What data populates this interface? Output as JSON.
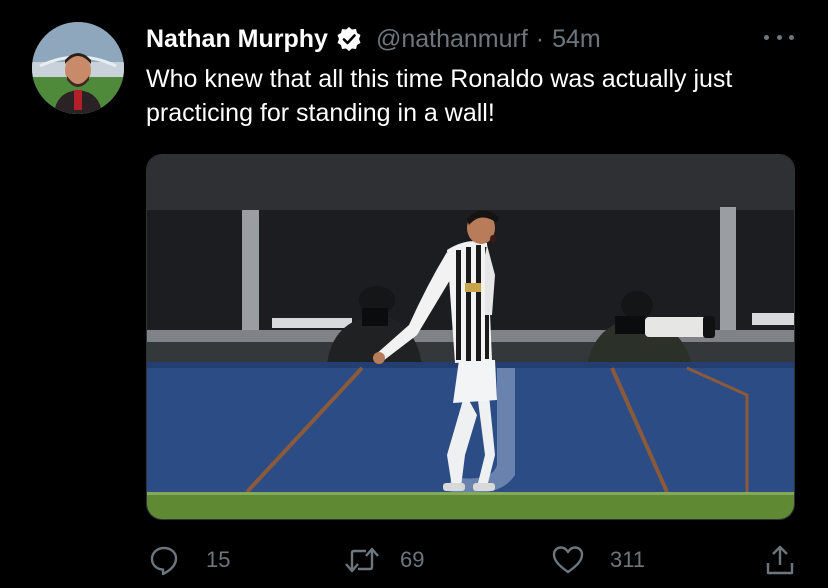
{
  "tweet": {
    "author_name": "Nathan Murphy",
    "handle": "@nathanmurf",
    "separator": "·",
    "time": "54m",
    "text": "Who knew that all this time Ronaldo was actually just practicing for standing in a wall!",
    "verified": true
  },
  "media": {
    "alt": "Ronaldo in a black and white striped kit walking on the pitch past photographers"
  },
  "actions": {
    "reply_count": "15",
    "retweet_count": "69",
    "like_count": "311"
  },
  "icons": {
    "more": "more-horizontal-icon",
    "reply": "reply-icon",
    "retweet": "retweet-icon",
    "like": "heart-icon",
    "share": "share-icon",
    "verified": "verified-badge-icon"
  },
  "colors": {
    "background": "#000000",
    "text_primary": "#ffffff",
    "text_secondary": "#6e767d",
    "divider": "#2f3336"
  }
}
